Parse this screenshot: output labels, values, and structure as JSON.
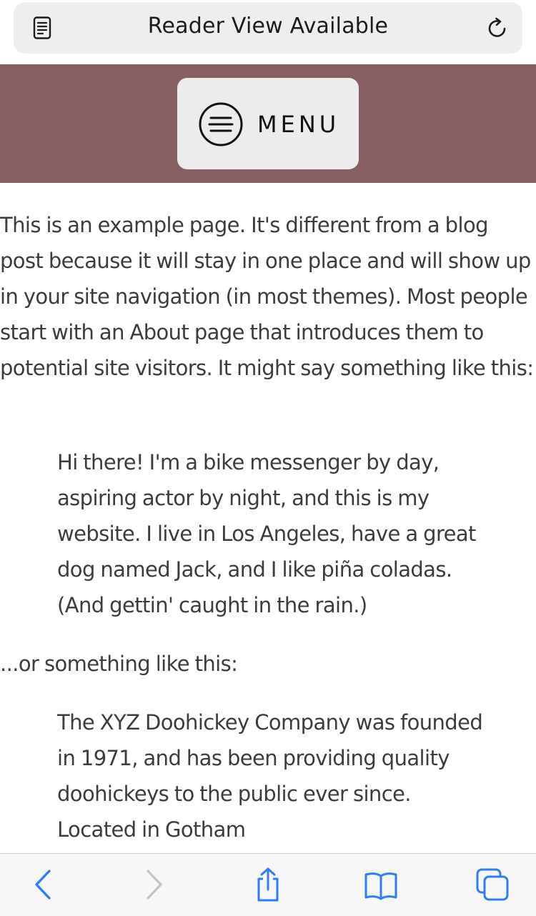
{
  "browser": {
    "address_bar_label": "Reader View Available",
    "icons": {
      "reader": "reader-view-icon",
      "reload": "reload-icon"
    },
    "accent_color": "#2f7cf6"
  },
  "site_header": {
    "background_color": "#875e62",
    "menu_label": "MENU"
  },
  "content": {
    "paragraph_1": "This is an example page. It's different from a blog post because it will stay in one place and will show up in your site navigation (in most themes). Most people start with an About page that introduces them to potential site visitors. It might say something like this:",
    "quote_1": "Hi there! I'm a bike messenger by day, aspiring actor by night, and this is my website. I live in Los Angeles, have a great dog named Jack, and I like piña coladas. (And gettin' caught in the rain.)",
    "paragraph_2": "...or something like this:",
    "quote_2": "The XYZ Doohickey Company was founded in 1971, and has been providing quality doohickeys to the public ever since. Located in Gotham"
  },
  "toolbar": {
    "buttons": [
      {
        "icon": "back-icon",
        "enabled": true
      },
      {
        "icon": "forward-icon",
        "enabled": false
      },
      {
        "icon": "share-icon",
        "enabled": true
      },
      {
        "icon": "bookmarks-icon",
        "enabled": true
      },
      {
        "icon": "tabs-icon",
        "enabled": true
      }
    ]
  }
}
